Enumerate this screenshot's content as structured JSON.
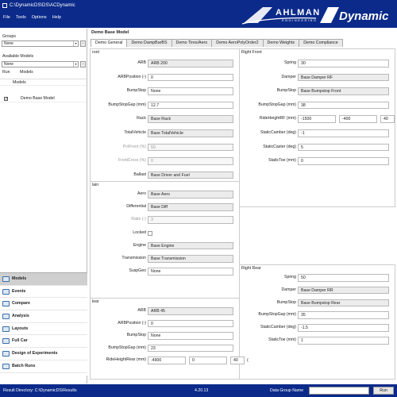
{
  "window": {
    "title": "C:\\DynamicDS\\DS\\ACDynamic"
  },
  "menu": [
    "File",
    "Tools",
    "Options",
    "Help"
  ],
  "brand": {
    "name1": "AHLMAN",
    "sub": "ENGINEERING",
    "name2": "Dynamic",
    "color": "#0b2a8a"
  },
  "left": {
    "groups_label": "Groups",
    "groups_value": "None",
    "models_label": "Available Models",
    "models_value": "None",
    "col_run": "Run",
    "col_models": "Models",
    "tree_header": "Models",
    "model_item": "Demo Base Model"
  },
  "nav": [
    {
      "label": "Models",
      "icon": "models-icon",
      "selected": true
    },
    {
      "label": "Events",
      "icon": "events-icon"
    },
    {
      "label": "Compare",
      "icon": "compare-icon"
    },
    {
      "label": "Analysis",
      "icon": "analysis-icon"
    },
    {
      "label": "Layouts",
      "icon": "layouts-icon"
    },
    {
      "label": "Full Car",
      "icon": "full-car-icon"
    },
    {
      "label": "Design of Experiments",
      "icon": "doe-icon"
    },
    {
      "label": "Batch Runs",
      "icon": "batch-runs-icon"
    }
  ],
  "content": {
    "title": "Demo Base Model",
    "tabs": [
      "Demo General",
      "Demo DampBarBS",
      "Demo Tires/Aero",
      "Demo AeroPolyOrder2",
      "Demo Weights",
      "Demo Compliance"
    ],
    "front": {
      "title": "ront",
      "rows": [
        {
          "label": "ARB",
          "value": "ARB 200"
        },
        {
          "label": "ARBPosition (-)",
          "value": "0"
        },
        {
          "label": "BumpStop",
          "value": "None"
        },
        {
          "label": "BumpStopGap (mm)",
          "value": "12.7"
        },
        {
          "label": "Rack",
          "value": "Base Rack"
        },
        {
          "label": "TotalVehicle",
          "value": "Base TotalVehicle"
        },
        {
          "label": "PctFront (%)",
          "value": "50"
        },
        {
          "label": "FrontCross (%)",
          "value": "0"
        },
        {
          "label": "Ballast",
          "value": "Base Driver and Fuel"
        }
      ]
    },
    "rightfront": {
      "title": "Right Front",
      "rows": [
        {
          "label": "Spring",
          "value": "30"
        },
        {
          "label": "Damper",
          "value": "Base Damper RF"
        },
        {
          "label": "BumpStop",
          "value": "Base Bumpstop Front"
        },
        {
          "label": "BumpStopGap (mm)",
          "value": "38"
        },
        {
          "label": "RideHeightRF (mm)",
          "v1": "-1500",
          "v2": "-400",
          "v3": "40",
          "unit": ")"
        },
        {
          "label": "StaticCamber (deg)",
          "value": "-1"
        },
        {
          "label": "StaticCaster (deg)",
          "value": "5"
        },
        {
          "label": "StaticToe (mm)",
          "value": "0"
        }
      ]
    },
    "main": {
      "title": "lain",
      "rows": [
        {
          "label": "Aero",
          "value": "Base Aero"
        },
        {
          "label": "Differential",
          "value": "Base Diff"
        },
        {
          "label": "Ratio (-)",
          "value": "3"
        },
        {
          "label": "Locked",
          "value": ""
        },
        {
          "label": "Engine",
          "value": "Base Engine"
        },
        {
          "label": "Transmission",
          "value": "Base Transmission"
        },
        {
          "label": "SuspGeo",
          "value": "None"
        }
      ]
    },
    "rear": {
      "title": "lear",
      "rows": [
        {
          "label": "ARB",
          "value": "ARB 45"
        },
        {
          "label": "ARBPosition (-)",
          "value": "0"
        },
        {
          "label": "BumpStop",
          "value": "None"
        },
        {
          "label": "BumpStopGap (mm)",
          "value": "23"
        },
        {
          "label": "RideHeightRear (mm)",
          "v1": "-4900",
          "v2": "0",
          "v3": "40",
          "unit": "("
        }
      ]
    },
    "rightrear": {
      "title": "Right Rear",
      "rows": [
        {
          "label": "Spring",
          "value": "50"
        },
        {
          "label": "Damper",
          "value": "Base Damper RR"
        },
        {
          "label": "BumpStop",
          "value": "Base Bumpstop Rear"
        },
        {
          "label": "BumpStopGap (mm)",
          "value": "35"
        },
        {
          "label": "StaticCamber (deg)",
          "value": "-1.5"
        },
        {
          "label": "StaticToe (mm)",
          "value": "1"
        }
      ]
    }
  },
  "status": {
    "dir": "Result Directory: C:\\DynamicDS\\Results",
    "version": "4.20.13",
    "dg_label": "Data Group Name",
    "run": "Run"
  }
}
